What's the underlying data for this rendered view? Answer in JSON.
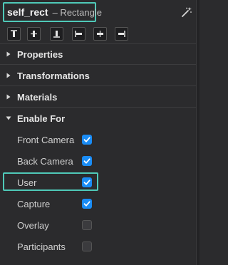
{
  "header": {
    "object_name": "self_rect",
    "object_type": "– Rectangle",
    "highlight_color": "#4fc9b8",
    "magic_icon": "magic-wand-icon"
  },
  "align_buttons": [
    {
      "name": "align-top-icon"
    },
    {
      "name": "align-vertical-center-icon"
    },
    {
      "name": "align-bottom-icon"
    },
    {
      "name": "align-left-icon"
    },
    {
      "name": "align-horizontal-center-icon"
    },
    {
      "name": "align-right-icon"
    }
  ],
  "sections": [
    {
      "label": "Properties",
      "expanded": false
    },
    {
      "label": "Transformations",
      "expanded": false
    },
    {
      "label": "Materials",
      "expanded": false
    },
    {
      "label": "Enable For",
      "expanded": true
    }
  ],
  "enable_for": [
    {
      "label": "Front Camera",
      "checked": true
    },
    {
      "label": "Back Camera",
      "checked": true
    },
    {
      "label": "User",
      "checked": true,
      "highlighted": true
    },
    {
      "label": "Capture",
      "checked": true
    },
    {
      "label": "Overlay",
      "checked": false
    },
    {
      "label": "Participants",
      "checked": false
    }
  ],
  "colors": {
    "checkbox_on": "#1a8cf5",
    "background": "#2b2b2d"
  }
}
